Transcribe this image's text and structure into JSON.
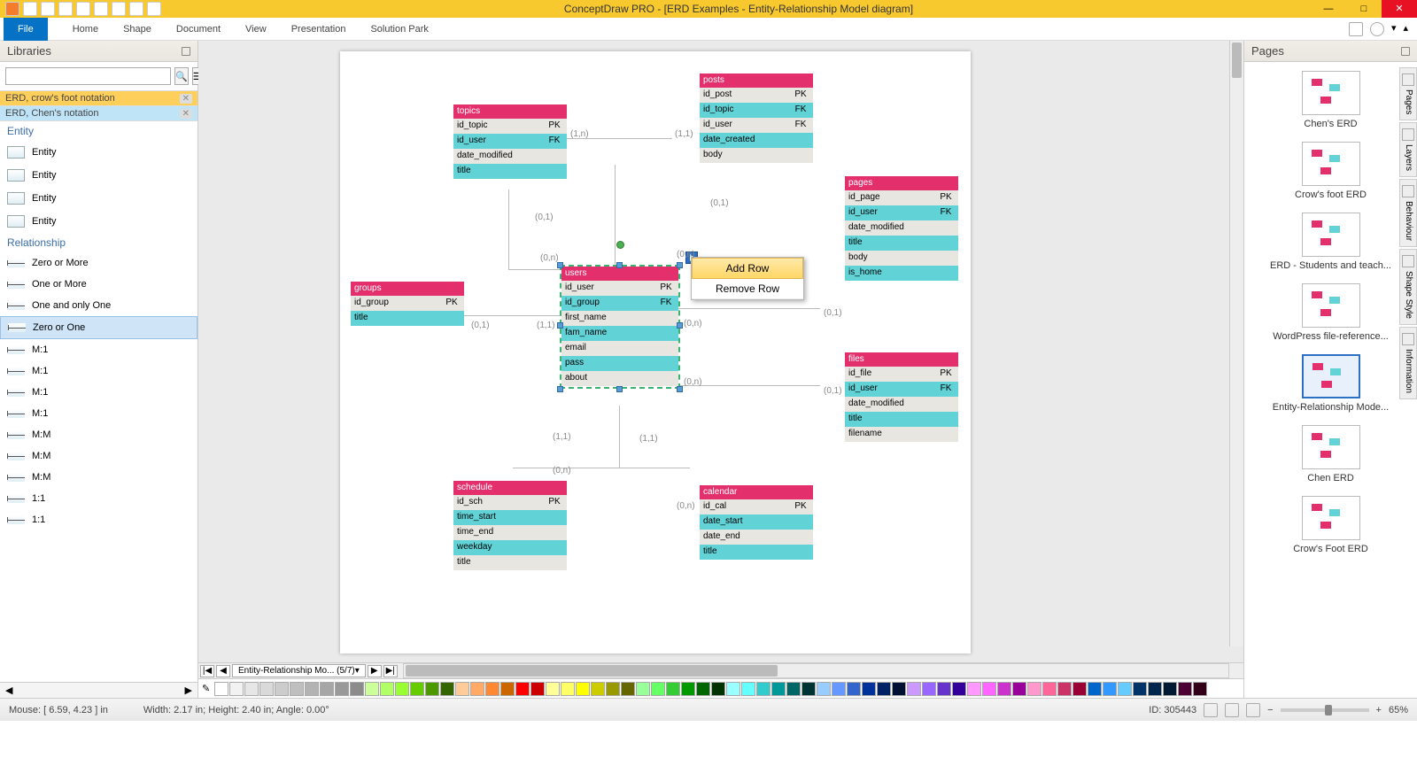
{
  "title": "ConceptDraw PRO - [ERD Examples - Entity-Relationship Model diagram]",
  "menubar": {
    "file": "File",
    "items": [
      "Home",
      "Shape",
      "Document",
      "View",
      "Presentation",
      "Solution Park"
    ]
  },
  "libraries": {
    "title": "Libraries",
    "search_placeholder": "",
    "categories": [
      {
        "label": "ERD, crow's foot notation",
        "active": true
      },
      {
        "label": "ERD, Chen's notation",
        "active": false
      }
    ],
    "section_entity": "Entity",
    "entity_items": [
      "Entity",
      "Entity",
      "Entity",
      "Entity"
    ],
    "section_relationship": "Relationship",
    "relationship_items": [
      {
        "label": "Zero or More",
        "sel": false
      },
      {
        "label": "One or More",
        "sel": false
      },
      {
        "label": "One and only One",
        "sel": false
      },
      {
        "label": "Zero or One",
        "sel": true
      },
      {
        "label": "M:1",
        "sel": false
      },
      {
        "label": "M:1",
        "sel": false
      },
      {
        "label": "M:1",
        "sel": false
      },
      {
        "label": "M:1",
        "sel": false
      },
      {
        "label": "M:M",
        "sel": false
      },
      {
        "label": "M:M",
        "sel": false
      },
      {
        "label": "M:M",
        "sel": false
      },
      {
        "label": "1:1",
        "sel": false
      },
      {
        "label": "1:1",
        "sel": false
      }
    ]
  },
  "sheet_tab": "Entity-Relationship Mo...  (5/7)",
  "context_menu": {
    "add": "Add Row",
    "remove": "Remove Row"
  },
  "erd": {
    "topics": {
      "title": "topics",
      "rows": [
        [
          "id_topic",
          "PK"
        ],
        [
          "id_user",
          "FK"
        ],
        [
          "date_modified",
          ""
        ],
        [
          "title",
          ""
        ]
      ]
    },
    "posts": {
      "title": "posts",
      "rows": [
        [
          "id_post",
          "PK"
        ],
        [
          "id_topic",
          "FK"
        ],
        [
          "id_user",
          "FK"
        ],
        [
          "date_created",
          ""
        ],
        [
          "body",
          ""
        ]
      ]
    },
    "pages": {
      "title": "pages",
      "rows": [
        [
          "id_page",
          "PK"
        ],
        [
          "id_user",
          "FK"
        ],
        [
          "date_modified",
          ""
        ],
        [
          "title",
          ""
        ],
        [
          "body",
          ""
        ],
        [
          "is_home",
          ""
        ]
      ]
    },
    "groups": {
      "title": "groups",
      "rows": [
        [
          "id_group",
          "PK"
        ],
        [
          "title",
          ""
        ]
      ]
    },
    "users": {
      "title": "users",
      "rows": [
        [
          "id_user",
          "PK"
        ],
        [
          "id_group",
          "FK"
        ],
        [
          "first_name",
          ""
        ],
        [
          "fam_name",
          ""
        ],
        [
          "email",
          ""
        ],
        [
          "pass",
          ""
        ],
        [
          "about",
          ""
        ]
      ]
    },
    "files": {
      "title": "files",
      "rows": [
        [
          "id_file",
          "PK"
        ],
        [
          "id_user",
          "FK"
        ],
        [
          "date_modified",
          ""
        ],
        [
          "title",
          ""
        ],
        [
          "filename",
          ""
        ]
      ]
    },
    "schedule": {
      "title": "schedule",
      "rows": [
        [
          "id_sch",
          "PK"
        ],
        [
          "time_start",
          ""
        ],
        [
          "time_end",
          ""
        ],
        [
          "weekday",
          ""
        ],
        [
          "title",
          ""
        ]
      ]
    },
    "calendar": {
      "title": "calendar",
      "rows": [
        [
          "id_cal",
          "PK"
        ],
        [
          "date_start",
          ""
        ],
        [
          "date_end",
          ""
        ],
        [
          "title",
          ""
        ]
      ]
    }
  },
  "conn_labels": {
    "a": "(1,n)",
    "b": "(1,1)",
    "c": "(0,1)",
    "d": "(0,1)",
    "e": "(0,n)",
    "f": "(0,n)",
    "g": "(0,1)",
    "h": "(1,1)",
    "i": "(0,n)",
    "j": "(0,1)",
    "k": "(0,n)",
    "l": "(1,1)",
    "m": "(1,1)",
    "n": "(0,n)",
    "o": "(0,n)",
    "p": "(0,n)"
  },
  "pages_panel": {
    "title": "Pages",
    "items": [
      {
        "label": "Chen's ERD",
        "sel": false
      },
      {
        "label": "Crow's foot ERD",
        "sel": false
      },
      {
        "label": "ERD - Students and teach...",
        "sel": false
      },
      {
        "label": "WordPress file-reference...",
        "sel": false
      },
      {
        "label": "Entity-Relationship Mode...",
        "sel": true
      },
      {
        "label": "Chen ERD",
        "sel": false
      },
      {
        "label": "Crow's Foot ERD",
        "sel": false
      }
    ]
  },
  "right_tabs": [
    "Pages",
    "Layers",
    "Behaviour",
    "Shape Style",
    "Information"
  ],
  "statusbar": {
    "mouse": "Mouse: [ 6.59, 4.23 ] in",
    "dims": "Width: 2.17 in;  Height: 2.40 in;  Angle: 0.00°",
    "id": "ID: 305443",
    "zoom": "65%"
  },
  "color_swatches": [
    "#ffffff",
    "#f2f2f2",
    "#e6e6e6",
    "#d9d9d9",
    "#cccccc",
    "#bfbfbf",
    "#b3b3b3",
    "#a6a6a6",
    "#999999",
    "#8c8c8c",
    "#ccff99",
    "#b3ff66",
    "#99ff33",
    "#66cc00",
    "#4d9900",
    "#336600",
    "#ffcc99",
    "#ffaa66",
    "#ff8833",
    "#cc6600",
    "#ff0000",
    "#cc0000",
    "#ffff99",
    "#ffff66",
    "#ffff00",
    "#cccc00",
    "#999900",
    "#666600",
    "#99ff99",
    "#66ff66",
    "#33cc33",
    "#009900",
    "#006600",
    "#003300",
    "#99ffff",
    "#66ffff",
    "#33cccc",
    "#009999",
    "#006666",
    "#003333",
    "#99ccff",
    "#6699ff",
    "#3366cc",
    "#003399",
    "#002266",
    "#001133",
    "#cc99ff",
    "#9966ff",
    "#6633cc",
    "#330099",
    "#ff99ff",
    "#ff66ff",
    "#cc33cc",
    "#990099",
    "#ff99cc",
    "#ff6699",
    "#cc3366",
    "#990033",
    "#0066cc",
    "#3399ff",
    "#66ccff",
    "#003366",
    "#00264d",
    "#001a33",
    "#4d0033",
    "#33001a"
  ]
}
